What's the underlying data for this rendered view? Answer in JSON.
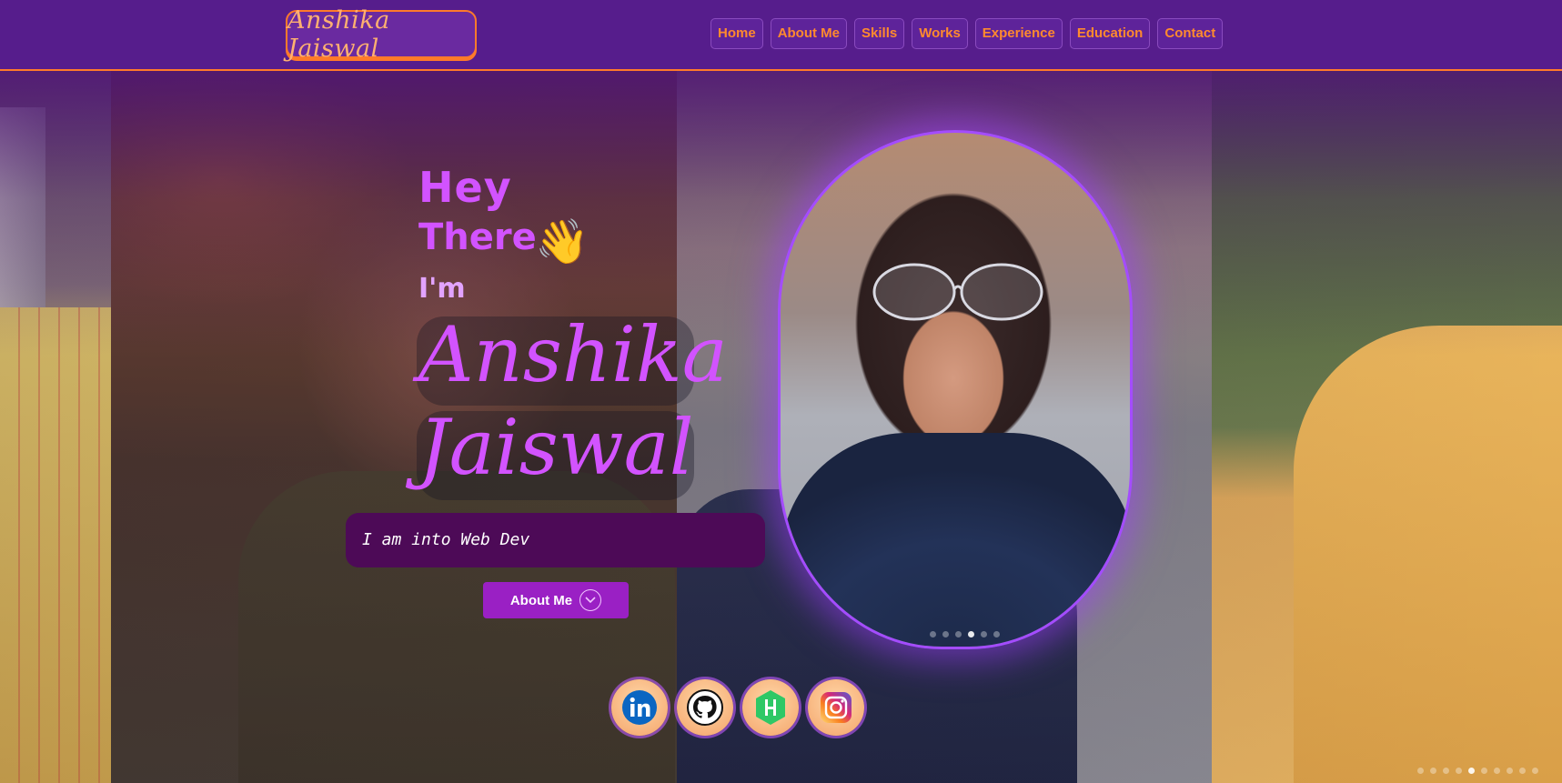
{
  "header": {
    "logo_text": "Anshika Jaiswal",
    "nav": [
      "Home",
      "About Me",
      "Skills",
      "Works",
      "Experience",
      "Education",
      "Contact"
    ]
  },
  "hero": {
    "greeting_line1": "Hey",
    "greeting_line2": "There",
    "wave_emoji": "👋",
    "im": "I'm",
    "first_name": "Anshika",
    "last_name": "Jaiswal",
    "tagline": "I am into Web Dev",
    "about_button": "About Me"
  },
  "socials": [
    {
      "name": "linkedin-icon",
      "label": "in",
      "color": "#0a66c2"
    },
    {
      "name": "github-icon",
      "label": "GitHub",
      "color": "#111111"
    },
    {
      "name": "hackerrank-icon",
      "label": "H",
      "color": "#2ec866"
    },
    {
      "name": "instagram-icon",
      "label": "Instagram",
      "color": "#d6249f"
    }
  ],
  "colors": {
    "header_bg": "#561d8c",
    "accent_orange": "#ff7a2a",
    "accent_purple": "#d253ff",
    "button_bg": "#9a20c4",
    "tagline_bg": "#4d0a57"
  }
}
